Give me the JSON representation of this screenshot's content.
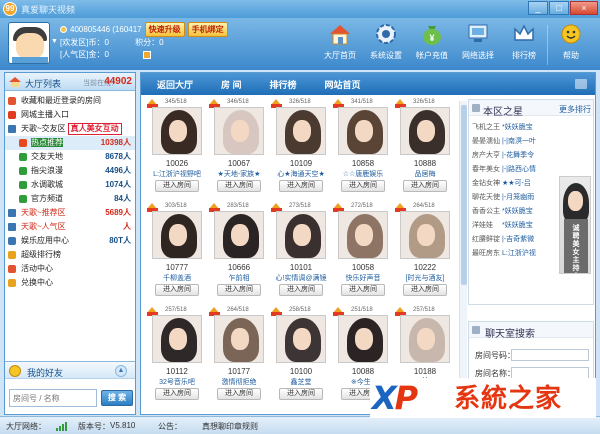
{
  "window": {
    "title": "真爱聊天视频",
    "buttons": [
      "_",
      "□",
      "×"
    ]
  },
  "user": {
    "id": "400805446 (160417",
    "upgrade_label": "快速升级",
    "bind_label": "手机绑定",
    "coin_label": "[欢发区]币：",
    "coin_value": "0",
    "score_label": "积分：",
    "score_value": "0",
    "popularity_label": "[人气区]金：",
    "popularity_value": "0"
  },
  "toolbar": [
    {
      "label": "大厅首页",
      "icon": "house-icon"
    },
    {
      "label": "系统设置",
      "icon": "gear-icon"
    },
    {
      "label": "帐户充值",
      "icon": "money-bag-icon"
    },
    {
      "label": "网络选择",
      "icon": "network-icon"
    },
    {
      "label": "排行榜",
      "icon": "crown-icon"
    },
    {
      "label": "帮助",
      "icon": "help-icon"
    }
  ],
  "lobby": {
    "title": "大厅列表",
    "online_label": "当前在线：",
    "online_value": "44902",
    "items": [
      {
        "label": "收藏和最近登录的房间",
        "icon": "room-icon",
        "level": 1,
        "count": ""
      },
      {
        "label": "网城主播入口",
        "icon": "heart-icon",
        "level": 1,
        "count": ""
      },
      {
        "label": "天歌~交友区",
        "icon": "expand-icon",
        "level": 1,
        "count": "",
        "tag": "真人美女互动"
      },
      {
        "label": "热点推荐",
        "icon": "fire-icon",
        "level": 2,
        "count": "10398人",
        "selected": true
      },
      {
        "label": "交友天地",
        "icon": "folder-icon",
        "level": 2,
        "count": "8678人"
      },
      {
        "label": "指尖浪漫",
        "icon": "folder-icon",
        "level": 2,
        "count": "4496人"
      },
      {
        "label": "水调歌城",
        "icon": "folder-icon",
        "level": 2,
        "count": "1074人"
      },
      {
        "label": "官方频道",
        "icon": "folder-icon",
        "level": 2,
        "count": "84人"
      },
      {
        "label": "天歌~推荐区",
        "icon": "expand-icon",
        "level": 1,
        "count": "5689人",
        "color": "#d22a18"
      },
      {
        "label": "天歌~人气区",
        "icon": "expand-icon",
        "level": 1,
        "count": "人",
        "color": "#d22a18"
      },
      {
        "label": "娱乐应用中心",
        "icon": "app-icon",
        "level": 1,
        "count": "80T人"
      },
      {
        "label": "超级排行榜",
        "icon": "trophy-icon",
        "level": 1,
        "count": ""
      },
      {
        "label": "活动中心",
        "icon": "event-icon",
        "level": 1,
        "count": ""
      },
      {
        "label": "兑换中心",
        "icon": "exchange-icon",
        "level": 1,
        "count": ""
      }
    ]
  },
  "friends": {
    "title": "我的好友",
    "search_placeholder": "房间号 / 名称",
    "search_button": "搜 索"
  },
  "nav": [
    "返回大厅",
    "房 间",
    "排行榜",
    "网站首页"
  ],
  "rooms": [
    {
      "cap": "345/518",
      "id": "10026",
      "name": "L:江浙沪视野吧",
      "enter": "进入房间",
      "hair": "#3a2a24"
    },
    {
      "cap": "346/518",
      "id": "10067",
      "name": "★天地-家族★",
      "enter": "进入房间",
      "hair": "#d7c7c0"
    },
    {
      "cap": "326/518",
      "id": "10109",
      "name": "心★海通天空★",
      "enter": "进入房间",
      "hair": "#4a3a30"
    },
    {
      "cap": "341/518",
      "id": "10858",
      "name": "☆☆唐鹿娱乐",
      "enter": "进入房间",
      "hair": "#5a4436"
    },
    {
      "cap": "326/518",
      "id": "10888",
      "name": "品居梅",
      "enter": "进入房间",
      "hair": "#3a2f2a"
    },
    {
      "cap": "303/518",
      "id": "10777",
      "name": "千柳盖酒",
      "enter": "进入房间",
      "hair": "#2f2622"
    },
    {
      "cap": "283/518",
      "id": "10666",
      "name": "乍前相",
      "enter": "进入房间",
      "hair": "#2a2424"
    },
    {
      "cap": "273/518",
      "id": "10101",
      "name": "心!实情调@满镜",
      "enter": "进入房间",
      "hair": "#3a3030"
    },
    {
      "cap": "272/518",
      "id": "10058",
      "name": "快乐好声音",
      "enter": "进入房间",
      "hair": "#8d7464"
    },
    {
      "cap": "264/518",
      "id": "10222",
      "name": "[时光与酒友]",
      "enter": "进入房间",
      "hair": "#b19a86"
    },
    {
      "cap": "257/518",
      "id": "10112",
      "name": "32号音乐吧",
      "enter": "进入房间",
      "hair": "#2f2828"
    },
    {
      "cap": "264/518",
      "id": "10177",
      "name": "激情彻拒绝",
      "enter": "进入房间",
      "hair": "#7a6556"
    },
    {
      "cap": "258/518",
      "id": "10100",
      "name": "鑫芝堂",
      "enter": "进入房间",
      "hair": "#3d3535"
    },
    {
      "cap": "251/518",
      "id": "10088",
      "name": "※今生 (",
      "enter": "进入房间",
      "hair": "#2c2424"
    },
    {
      "cap": "257/518",
      "id": "10188",
      "name": "Y",
      "enter": "进入房间",
      "hair": "#c8b7ad"
    }
  ],
  "star": {
    "title": "本区之星",
    "more": "更多排行",
    "rows": [
      {
        "cat": "飞机之王",
        "name": "*妖妖脆宝"
      },
      {
        "cat": "晏晏濡仙",
        "name": "|-|南溟一叶"
      },
      {
        "cat": "房产大亨",
        "name": "|-花舞季令"
      },
      {
        "cat": "春年美女",
        "name": "|-|路西心情"
      },
      {
        "cat": "金钻女神",
        "name": "★★可-吕"
      },
      {
        "cat": "聊花天使",
        "name": "|-月笼幽雨"
      },
      {
        "cat": "香香公主",
        "name": "*妖妖脆宝"
      },
      {
        "cat": "洋娃娃",
        "name": "*妖妖脆宝"
      },
      {
        "cat": "红腰鲜锭",
        "name": "|-吉奇紫微"
      },
      {
        "cat": "最旺房东",
        "name": "L:江浙沪视"
      }
    ],
    "poster_text": "诚聘美女主持人"
  },
  "chat": {
    "title": "聊天室搜索",
    "room_label": "房间号码：",
    "name_label": "房间名称："
  },
  "status": {
    "network_label": "大厅网络：",
    "version_label": "版本号：",
    "version_value": "V5.810",
    "notice_label": "公告：",
    "notice_value": "真想聊印章规则"
  },
  "watermark": {
    "brand_a": "X",
    "brand_b": "P",
    "brand_cn": "系統之家"
  }
}
